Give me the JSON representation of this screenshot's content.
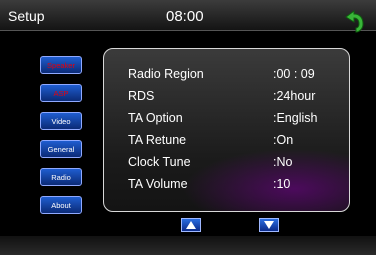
{
  "header": {
    "title": "Setup",
    "time": "08:00"
  },
  "sidebar": {
    "items": [
      {
        "label": "Speaker",
        "active": true
      },
      {
        "label": "ASP",
        "active": true
      },
      {
        "label": "Video",
        "active": false
      },
      {
        "label": "General",
        "active": false
      },
      {
        "label": "Radio",
        "active": false
      },
      {
        "label": "About",
        "active": false
      }
    ]
  },
  "settings": [
    {
      "label": "Radio Region",
      "value": ":00  :  09"
    },
    {
      "label": "RDS",
      "value": ":24hour"
    },
    {
      "label": "TA Option",
      "value": ":English"
    },
    {
      "label": "TA Retune",
      "value": ":On"
    },
    {
      "label": "Clock Tune",
      "value": ":No"
    },
    {
      "label": "TA Volume",
      "value": ":10"
    }
  ],
  "icons": {
    "back": "back-arrow-icon",
    "up": "chevron-up-icon",
    "down": "chevron-down-icon"
  },
  "colors": {
    "accent": "#2f9e2f",
    "active_text": "#e7000b",
    "button_blue": "#1f5dd0"
  }
}
